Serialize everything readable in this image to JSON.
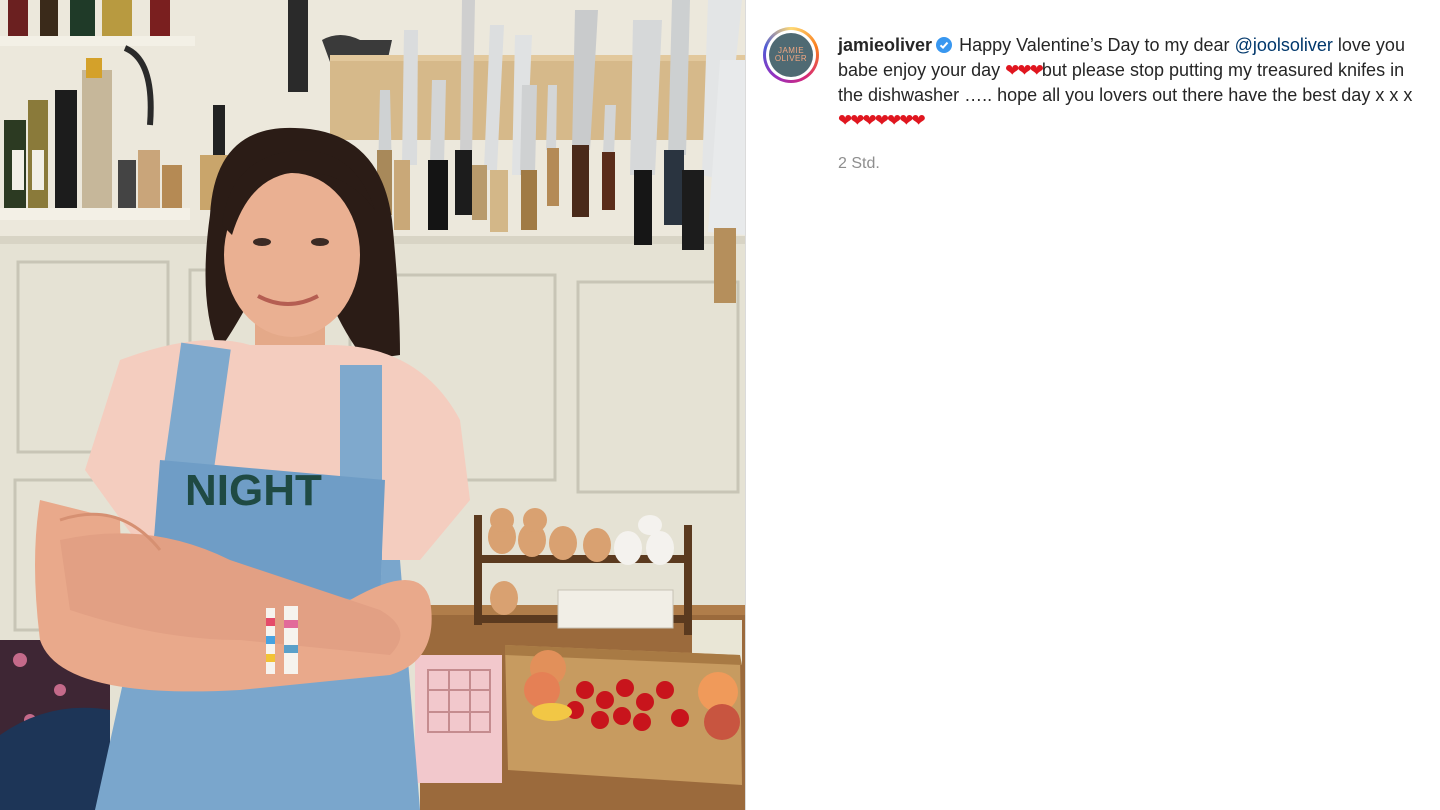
{
  "post": {
    "image_alt": "Woman in denim overalls with arms crossed in a kitchen with knives on a magnetic rack",
    "photo_text": {
      "shirt_text": "NIGHT"
    }
  },
  "author": {
    "avatar_text": "JAMIE OLIVER",
    "username": "jamieoliver",
    "verified": true
  },
  "caption": {
    "text1": "Happy Valentine’s Day to my dear",
    "mention": "@joolsoliver",
    "text2": "love you babe enjoy your day",
    "hearts1": "❤❤❤",
    "text3": "but please stop putting my treasured knifes in the dishwasher ….. hope all you lovers out there have the best day x x x",
    "hearts2": "❤❤❤❤❤❤❤"
  },
  "timestamp": "2 Std.",
  "colors": {
    "mention": "#00376b",
    "verified": "#3897f0",
    "heart": "#e0161f",
    "text": "#262626",
    "muted": "#8e8e8e"
  }
}
